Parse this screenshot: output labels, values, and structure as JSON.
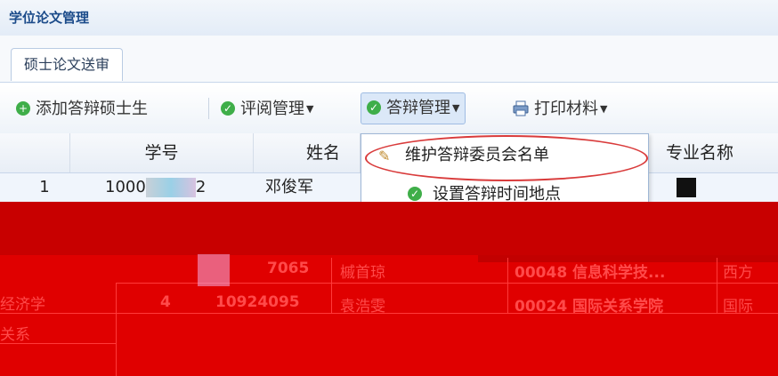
{
  "window": {
    "title": "学位论文管理"
  },
  "tabs": [
    {
      "label": "硕士论文送审"
    }
  ],
  "toolbar": {
    "add_label": "添加答辩硕士生",
    "review_label": "评阅管理",
    "defense_label": "答辩管理",
    "print_label": "打印材料"
  },
  "grid": {
    "headers": {
      "student_id": "学号",
      "name": "姓名",
      "major": "专业名称"
    },
    "rows": [
      {
        "no": "1",
        "student_id_prefix": "1000",
        "student_id_suffix": "2",
        "name": "邓俊军"
      },
      {
        "no": "",
        "student_id_suffix": "7065",
        "name": "槭首琼",
        "college": "00048 信息科学技...",
        "major": "西方"
      },
      {
        "no": "4",
        "student_id": "10924095",
        "name": "袁浩雯",
        "college": "00024 国际关系学院",
        "major": "国际"
      }
    ],
    "left_fragments": [
      "经济学",
      "关系"
    ]
  },
  "menu": {
    "items": [
      {
        "label": "维护答辩委员会名单",
        "icon": "pencil-icon"
      },
      {
        "label": "设置答辩时间地点",
        "icon": "check-circle-icon"
      }
    ]
  },
  "colors": {
    "accent": "#1b4b8a",
    "highlight_oval": "#d93b3b",
    "redaction": "#e00000"
  }
}
